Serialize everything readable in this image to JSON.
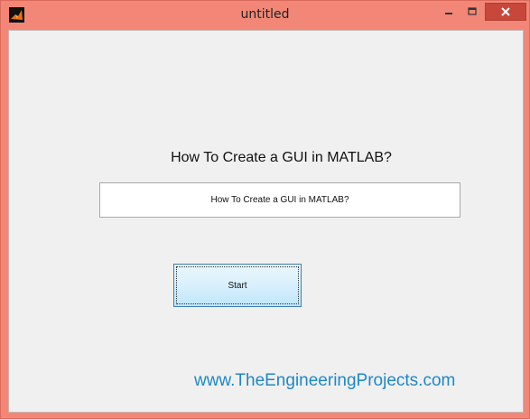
{
  "window": {
    "title": "untitled",
    "icon": "matlab-icon",
    "controls": {
      "minimize_icon": "minimize-icon",
      "maximize_icon": "maximize-icon",
      "close_icon": "close-icon"
    }
  },
  "figure": {
    "static_text": "How To Create a GUI in MATLAB?",
    "edit_value": "How To Create a GUI in MATLAB?",
    "start_button_label": "Start"
  },
  "watermark": "www.TheEngineeringProjects.com",
  "colors": {
    "frame": "#f28777",
    "client_bg": "#f0f0f0",
    "close_button": "#c7473b",
    "watermark_text": "#1e88c8",
    "button_border": "#3c7fb1"
  }
}
